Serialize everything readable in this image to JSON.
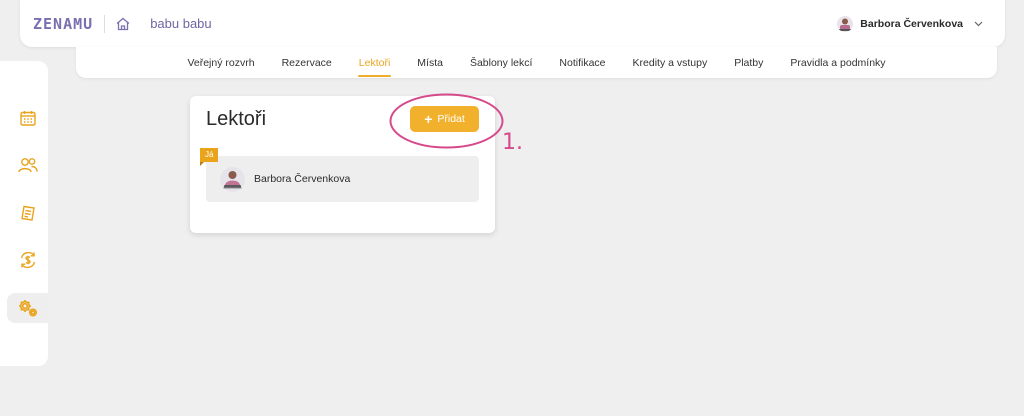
{
  "header": {
    "logo": "ZENAMU",
    "studio": "babu babu",
    "user": "Barbora Červenkova",
    "icons": {
      "home": "home-icon",
      "dropdown": "chevron-down-icon"
    }
  },
  "nav": {
    "items": [
      {
        "label": "Veřejný rozvrh"
      },
      {
        "label": "Rezervace"
      },
      {
        "label": "Lektoři",
        "active": true
      },
      {
        "label": "Místa"
      },
      {
        "label": "Šablony lekcí"
      },
      {
        "label": "Notifikace"
      },
      {
        "label": "Kredity a vstupy"
      },
      {
        "label": "Platby"
      },
      {
        "label": "Pravidla a podmínky"
      }
    ]
  },
  "sidebar": {
    "items": [
      {
        "icon": "calendar-icon"
      },
      {
        "icon": "users-icon"
      },
      {
        "icon": "documents-icon"
      },
      {
        "icon": "payments-icon"
      },
      {
        "icon": "settings-icon",
        "active": true
      }
    ]
  },
  "card": {
    "title": "Lektoři",
    "add_label": "Přidat",
    "lectors": [
      {
        "name": "Barbora Červenkova",
        "badge": "Já"
      }
    ]
  },
  "annotation": {
    "label": "1."
  },
  "colors": {
    "accent": "#f2b12d",
    "active_nav": "#e9a41c",
    "logo": "#7b6fb0",
    "annotation": "#d64a8c",
    "background": "#efefef"
  }
}
